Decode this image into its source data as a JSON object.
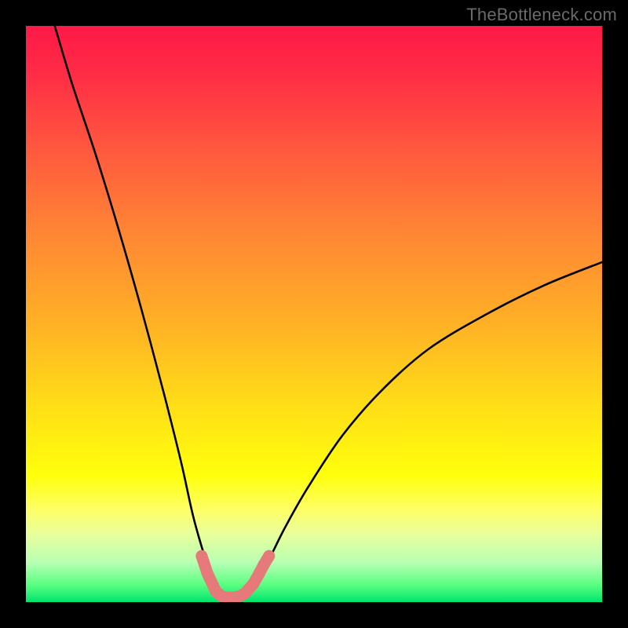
{
  "watermark": "TheBottleneck.com",
  "colors": {
    "frame": "#000000",
    "curve": "#000000",
    "markers": "#e67a7a",
    "gradient_top": "#ff1947",
    "gradient_mid": "#ffde17",
    "gradient_bottom": "#00e46a"
  },
  "chart_data": {
    "type": "line",
    "title": "",
    "xlabel": "",
    "ylabel": "",
    "xlim": [
      0,
      100
    ],
    "ylim": [
      0,
      100
    ],
    "grid": false,
    "series": [
      {
        "name": "bottleneck-curve",
        "x": [
          5,
          8,
          12,
          16,
          20,
          24,
          27,
          29,
          31,
          32.5,
          34,
          35,
          36,
          37,
          38.5,
          40,
          42,
          45,
          49,
          55,
          62,
          70,
          80,
          90,
          100
        ],
        "y": [
          100,
          90,
          78,
          65,
          51,
          36,
          24,
          15,
          8,
          4,
          1.5,
          0.8,
          0.6,
          0.8,
          1.5,
          3.5,
          7,
          13,
          20,
          29,
          37,
          44,
          50,
          55,
          59
        ]
      }
    ],
    "markers": {
      "name": "highlight-near-minimum",
      "style": "rounded-segment",
      "x": [
        30.5,
        31.5,
        33,
        34,
        35,
        36,
        37,
        38,
        39.5,
        40.5,
        41.3,
        42.2
      ],
      "y": [
        8,
        5,
        1.8,
        1.0,
        0.8,
        0.8,
        1.0,
        1.5,
        3.2,
        5.0,
        6.5,
        8.0
      ]
    },
    "annotations": [
      {
        "text": "TheBottleneck.com",
        "position": "top-right"
      }
    ]
  }
}
